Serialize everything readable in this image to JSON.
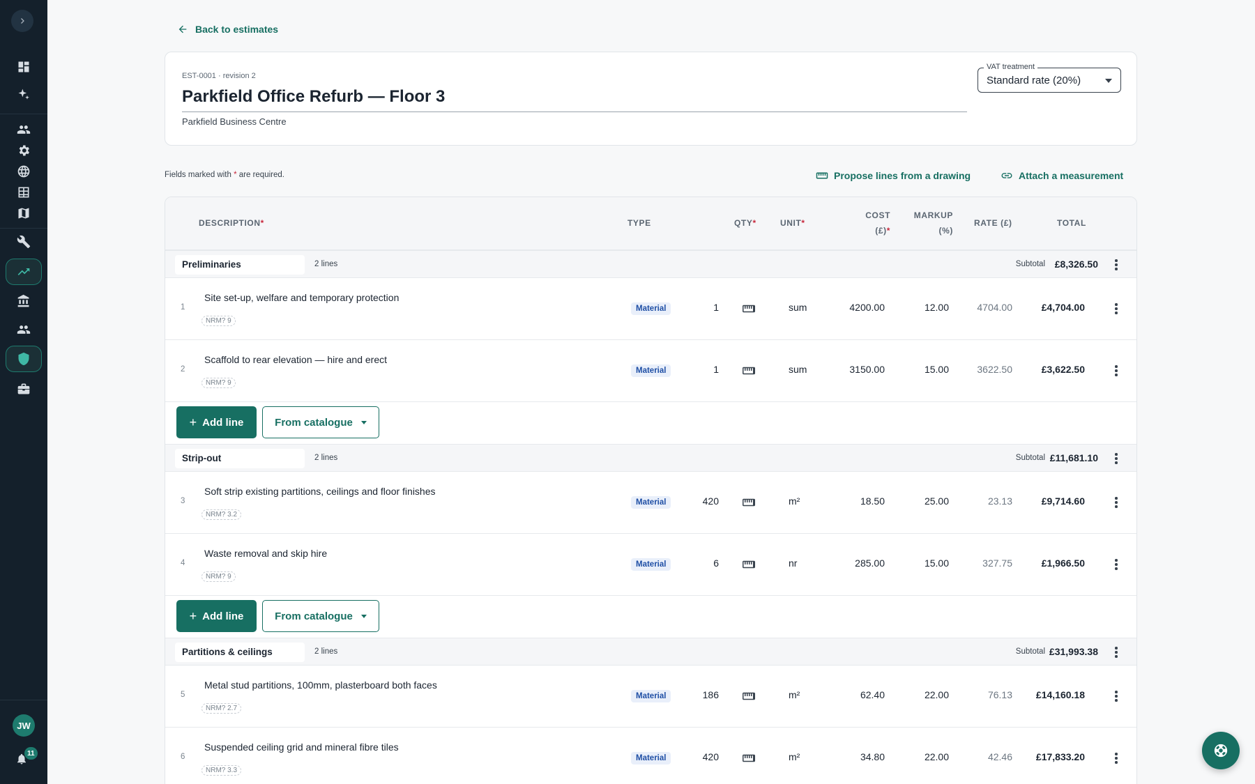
{
  "sidebar": {
    "avatar_initials": "JW",
    "notifications_count": "11",
    "icons": [
      "dashboard-icon",
      "sparkles-icon",
      "people-icon",
      "gear-icon",
      "globe-icon",
      "table-icon",
      "map-icon",
      "wrench-icon",
      "trending-up-icon",
      "bank-icon",
      "team-icon",
      "shield-icon",
      "briefcase-icon"
    ]
  },
  "nav": {
    "back_label": "Back to estimates"
  },
  "estimate": {
    "ref": "EST-0001 · revision 2",
    "title": "Parkfield Office Refurb — Floor 3",
    "client": "Parkfield Business Centre",
    "vat": {
      "label": "VAT treatment",
      "value": "Standard rate (20%)"
    }
  },
  "notes": {
    "required_prefix": "Fields marked with",
    "required_star": "*",
    "required_suffix": "are required."
  },
  "actions": {
    "propose": "Propose lines from a drawing",
    "attach": "Attach a measurement"
  },
  "columns": {
    "description": "Description",
    "type": "Type",
    "qty": "Qty",
    "unit": "Unit",
    "cost_l1": "Cost",
    "cost_l2": "(£)",
    "markup_l1": "Markup",
    "markup_l2": "(%)",
    "rate": "Rate (£)",
    "total": "Total",
    "req": "*"
  },
  "buttons": {
    "add_line": "Add line",
    "add_plus": "+",
    "from_catalogue": "From catalogue"
  },
  "subtotal_label": "Subtotal",
  "groups": [
    {
      "name": "Preliminaries",
      "count": "2 lines",
      "subtotal": "£8,326.50",
      "lines": [
        {
          "num": "1",
          "desc": "Site set-up, welfare and temporary protection",
          "nrm": "NRM? 9",
          "type": "Material",
          "qty": "1",
          "unit": "sum",
          "cost": "4200.00",
          "markup": "12.00",
          "rate": "4704.00",
          "total": "£4,704.00"
        },
        {
          "num": "2",
          "desc": "Scaffold to rear elevation — hire and erect",
          "nrm": "NRM? 9",
          "type": "Material",
          "qty": "1",
          "unit": "sum",
          "cost": "3150.00",
          "markup": "15.00",
          "rate": "3622.50",
          "total": "£3,622.50"
        }
      ]
    },
    {
      "name": "Strip-out",
      "count": "2 lines",
      "subtotal": "£11,681.10",
      "lines": [
        {
          "num": "3",
          "desc": "Soft strip existing partitions, ceilings and floor finishes",
          "nrm": "NRM? 3.2",
          "type": "Material",
          "qty": "420",
          "unit": "m²",
          "cost": "18.50",
          "markup": "25.00",
          "rate": "23.13",
          "total": "£9,714.60"
        },
        {
          "num": "4",
          "desc": "Waste removal and skip hire",
          "nrm": "NRM? 9",
          "type": "Material",
          "qty": "6",
          "unit": "nr",
          "cost": "285.00",
          "markup": "15.00",
          "rate": "327.75",
          "total": "£1,966.50"
        }
      ]
    },
    {
      "name": "Partitions & ceilings",
      "count": "2 lines",
      "subtotal": "£31,993.38",
      "lines": [
        {
          "num": "5",
          "desc": "Metal stud partitions, 100mm, plasterboard both faces",
          "nrm": "NRM? 2.7",
          "type": "Material",
          "qty": "186",
          "unit": "m²",
          "cost": "62.40",
          "markup": "22.00",
          "rate": "76.13",
          "total": "£14,160.18"
        },
        {
          "num": "6",
          "desc": "Suspended ceiling grid and mineral fibre tiles",
          "nrm": "NRM? 3.3",
          "type": "Material",
          "qty": "420",
          "unit": "m²",
          "cost": "34.80",
          "markup": "22.00",
          "rate": "42.46",
          "total": "£17,833.20"
        }
      ]
    }
  ]
}
